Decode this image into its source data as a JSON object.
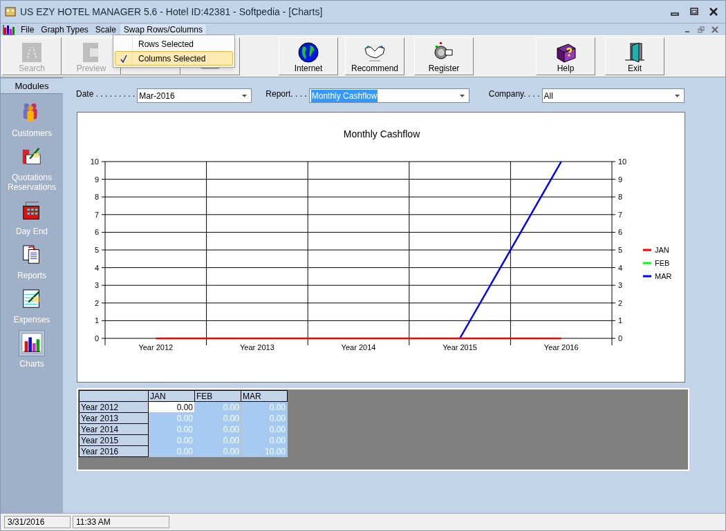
{
  "window": {
    "title": "US EZY HOTEL MANAGER 5.6 - Hotel ID:42381 - Softpedia - [Charts]"
  },
  "menu_bar": [
    {
      "label": "File",
      "open": false
    },
    {
      "label": "Graph Types",
      "open": false
    },
    {
      "label": "Scale",
      "open": false
    },
    {
      "label": "Swap Rows/Columns",
      "open": true
    }
  ],
  "open_menu": [
    {
      "label": "Rows Selected",
      "checked": false,
      "highlighted": false
    },
    {
      "label": "Columns Selected",
      "checked": true,
      "highlighted": true
    }
  ],
  "toolbar": [
    {
      "kind": "search",
      "label": "Search",
      "disabled": true
    },
    {
      "kind": "preview",
      "label": "Preview",
      "disabled": true
    },
    {
      "kind": "print"
    },
    {
      "kind": "email"
    },
    {
      "kind": "internet",
      "label": "Internet",
      "disabled": false
    },
    {
      "kind": "recommend",
      "label": "Recommend",
      "disabled": false
    },
    {
      "kind": "register",
      "label": "Register",
      "disabled": false
    },
    {
      "kind": "help",
      "label": "Help",
      "disabled": false
    },
    {
      "kind": "exit",
      "label": "Exit",
      "disabled": false
    }
  ],
  "sidebar": {
    "title": "Modules",
    "items": [
      {
        "kind": "customers",
        "label": "Customers",
        "selected": false
      },
      {
        "kind": "quotations",
        "label": "Quotations Reservations",
        "selected": false
      },
      {
        "kind": "dayend",
        "label": "Day End",
        "selected": false
      },
      {
        "kind": "reports",
        "label": "Reports",
        "selected": false
      },
      {
        "kind": "expenses",
        "label": "Expenses",
        "selected": false
      },
      {
        "kind": "charts",
        "label": "Charts",
        "selected": true
      }
    ]
  },
  "filters": [
    {
      "label": "Date . . . . . . . . .",
      "value": "Mar-2016",
      "highlighted": false
    },
    {
      "label": "Report. . . .",
      "value": "Monthly Cashflow",
      "highlighted": true
    },
    {
      "label": "Company. . . .",
      "value": "All",
      "highlighted": false
    }
  ],
  "chart": {
    "chart_data": {
      "type": "line",
      "title": "Monthly Cashflow",
      "categories": [
        "Year 2012",
        "Year 2013",
        "Year 2014",
        "Year 2015",
        "Year 2016"
      ],
      "ylim": [
        0,
        10
      ],
      "yticks": [
        0,
        1,
        2,
        3,
        4,
        5,
        6,
        7,
        8,
        9,
        10
      ],
      "grid": true,
      "legend": true,
      "series": [
        {
          "name": "JAN",
          "color": "#ff0000",
          "values": [
            0,
            0,
            0,
            0,
            0
          ]
        },
        {
          "name": "FEB",
          "color": "#00ff00",
          "values": [
            null,
            null,
            null,
            null,
            null
          ]
        },
        {
          "name": "MAR",
          "color": "#0000ff",
          "values": [
            null,
            null,
            null,
            0,
            10
          ]
        }
      ]
    },
    "right_axis_labels": [
      "10",
      "9",
      "8",
      "7",
      "6",
      "5",
      "4",
      "3",
      "2",
      "1",
      "0"
    ]
  },
  "grid": {
    "columns": [
      "JAN",
      "FEB",
      "MAR"
    ],
    "rows": [
      {
        "label": "Year 2012",
        "cells": [
          {
            "text": "0.00",
            "selected": false
          },
          {
            "text": "0.00",
            "selected": true
          },
          {
            "text": "0.00",
            "selected": true
          }
        ]
      },
      {
        "label": "Year 2013",
        "cells": [
          {
            "text": "0.00",
            "selected": true
          },
          {
            "text": "0.00",
            "selected": true
          },
          {
            "text": "0.00",
            "selected": true
          }
        ]
      },
      {
        "label": "Year 2014",
        "cells": [
          {
            "text": "0.00",
            "selected": true
          },
          {
            "text": "0.00",
            "selected": true
          },
          {
            "text": "0.00",
            "selected": true
          }
        ]
      },
      {
        "label": "Year 2015",
        "cells": [
          {
            "text": "0.00",
            "selected": true
          },
          {
            "text": "0.00",
            "selected": true
          },
          {
            "text": "0.00",
            "selected": true
          }
        ]
      },
      {
        "label": "Year 2016",
        "cells": [
          {
            "text": "0.00",
            "selected": true
          },
          {
            "text": "0.00",
            "selected": true
          },
          {
            "text": "10.00",
            "selected": true
          }
        ]
      }
    ]
  },
  "status_bar": [
    "3/31/2016",
    "11:33 AM"
  ]
}
